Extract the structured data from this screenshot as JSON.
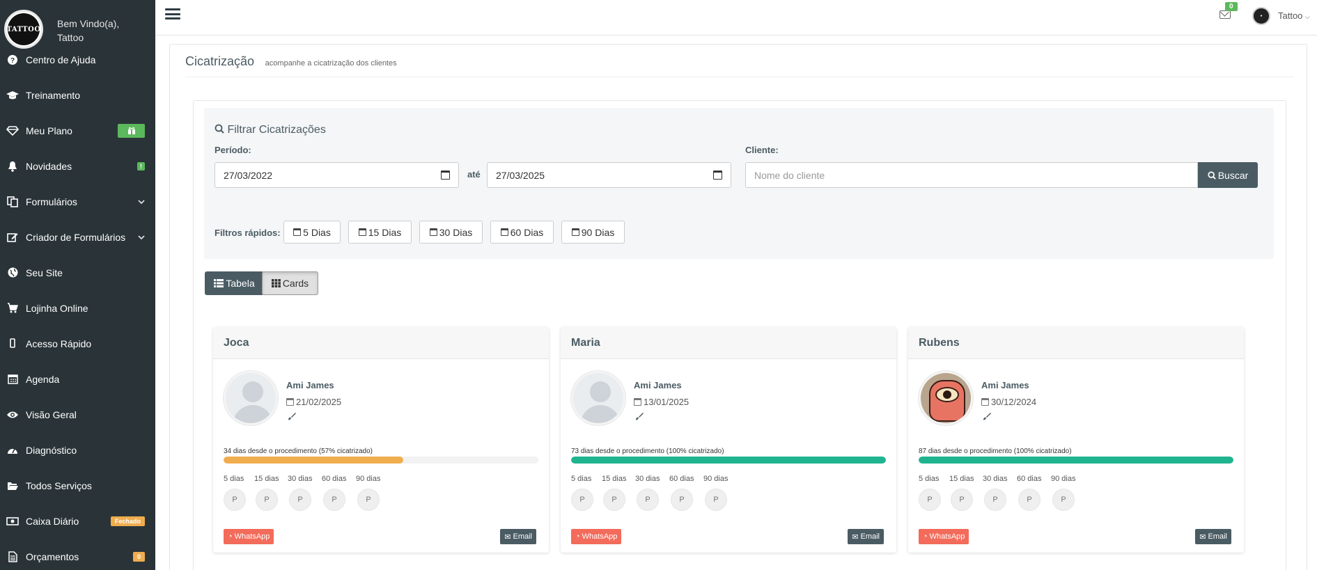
{
  "sidebar": {
    "welcome_line1": "Bem Vindo(a),",
    "welcome_line2": "Tattoo",
    "logo_text": "TATTOO",
    "items": [
      {
        "label": "Centro de Ajuda",
        "icon": "question-circle-icon"
      },
      {
        "label": "Treinamento",
        "icon": "graduation-cap-icon"
      },
      {
        "label": "Meu Plano",
        "icon": "diamond-icon",
        "badge": "gift"
      },
      {
        "label": "Novidades",
        "icon": "bell-icon",
        "badge": "!"
      },
      {
        "label": "Formulários",
        "icon": "file-icon",
        "chevron": true
      },
      {
        "label": "Criador de Formulários",
        "icon": "edit-icon",
        "chevron": true
      },
      {
        "label": "Seu Site",
        "icon": "globe-icon"
      },
      {
        "label": "Lojinha Online",
        "icon": "cart-icon"
      },
      {
        "label": "Acesso Rápido",
        "icon": "mobile-icon"
      },
      {
        "label": "Agenda",
        "icon": "calendar-icon"
      },
      {
        "label": "Visão Geral",
        "icon": "eye-icon"
      },
      {
        "label": "Diagnóstico",
        "icon": "dashboard-icon"
      },
      {
        "label": "Todos Serviços",
        "icon": "folder-open-icon"
      },
      {
        "label": "Caixa Diário",
        "icon": "money-icon",
        "badge": "Fechado"
      },
      {
        "label": "Orçamentos",
        "icon": "file-text-icon",
        "badge": "0"
      }
    ]
  },
  "topbar": {
    "mail_count": "0",
    "user_name": "Tattoo"
  },
  "page": {
    "title": "Cicatrização",
    "subtitle": "acompanhe a cicatrização dos clientes"
  },
  "filter": {
    "title": "Filtrar Cicatrizações",
    "period_label": "Período:",
    "date_from": "27/03/2022",
    "until_label": "até",
    "date_to": "27/03/2025",
    "client_label": "Cliente:",
    "client_placeholder": "Nome do cliente",
    "search_button": "Buscar",
    "quick_label": "Filtros rápidos:",
    "quick_filters": [
      "5 Dias",
      "15 Dias",
      "30 Dias",
      "60 Dias",
      "90 Dias"
    ]
  },
  "view": {
    "table_label": "Tabela",
    "cards_label": "Cards"
  },
  "card_common": {
    "days_labels": [
      "5 dias",
      "15 dias",
      "30 dias",
      "60 dias",
      "90 dias"
    ],
    "circle_label": "P",
    "whatsapp_label": "WhatsApp",
    "email_label": "Email"
  },
  "cards": [
    {
      "client": "Joca",
      "artist": "Ami James",
      "date": "21/02/2025",
      "progress_text": "34 dias desde o procedimento (57% cicatrizado)",
      "progress": 57,
      "color": "#f0ad4e",
      "photo": false
    },
    {
      "client": "Maria",
      "artist": "Ami James",
      "date": "13/01/2025",
      "progress_text": "73 dias desde o procedimento (100% cicatrizado)",
      "progress": 100,
      "color": "#1fb48f",
      "photo": false
    },
    {
      "client": "Rubens",
      "artist": "Ami James",
      "date": "30/12/2024",
      "progress_text": "87 dias desde o procedimento (100% cicatrizado)",
      "progress": 100,
      "color": "#1fb48f",
      "photo": true
    }
  ]
}
